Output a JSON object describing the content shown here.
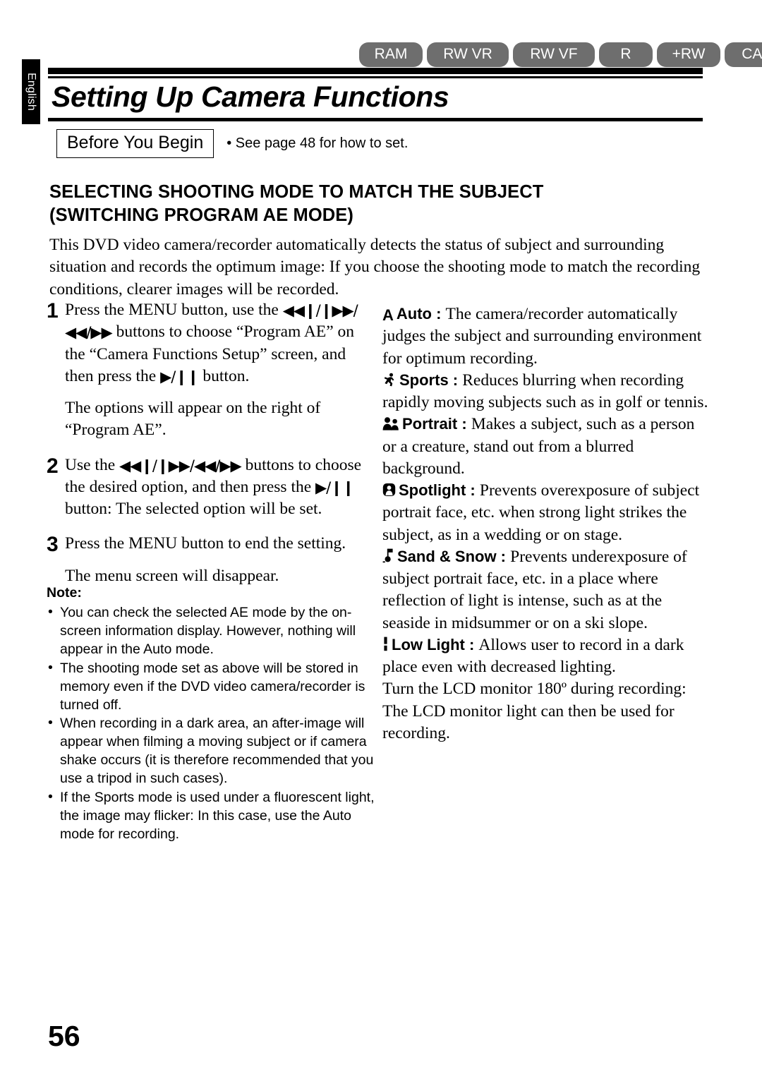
{
  "language_tab": "English",
  "media_badges": [
    {
      "id": "ram",
      "label": "RAM"
    },
    {
      "id": "rw-vr",
      "label": "RW VR"
    },
    {
      "id": "rw-vf",
      "label": "RW VF"
    },
    {
      "id": "r",
      "label": "R"
    },
    {
      "id": "plus-rw",
      "label": "+RW"
    },
    {
      "id": "card",
      "label": "CARD"
    }
  ],
  "badge_color": "#6e6e6e",
  "header": {
    "title": "Setting Up Camera Functions"
  },
  "before_you_begin": {
    "box_label": "Before You Begin",
    "note": "• See page 48 for how to set."
  },
  "section": {
    "heading_line1": "SELECTING SHOOTING MODE TO MATCH THE SUBJECT",
    "heading_line2": "(SWITCHING PROGRAM AE MODE)",
    "intro": "This DVD video camera/recorder automatically detects the status of subject and surrounding situation and records the optimum image: If you choose the shooting mode to match the recording conditions, clearer images will be recorded."
  },
  "steps": [
    {
      "number": "1",
      "text_part1": "Press the MENU button, use the ",
      "glyph1": "⏮⏭",
      "text_part2": " buttons to choose “Program AE” on the “Camera Functions Setup” screen, and then press the ",
      "glyph2": "▶/❙❙",
      "text_part3": " button.",
      "sub": "The options will appear on the right of “Program AE”."
    },
    {
      "number": "2",
      "text_part1": "Use the ",
      "glyph1": "⏮⏭",
      "text_part2": " buttons to choose the desired option, and then press the ",
      "glyph2": "▶/❙❙",
      "text_part3": " button: The selected option will be set.",
      "sub": ""
    },
    {
      "number": "3",
      "text_part1": "Press the MENU button to end the setting.",
      "glyph1": "",
      "text_part2": "",
      "glyph2": "",
      "text_part3": "",
      "sub": "The menu screen will disappear."
    }
  ],
  "glyphs": {
    "skip_back": "◀◀❙",
    "skip_fwd": "❙▶▶",
    "rew": "◀◀",
    "ff": "▶▶",
    "play_pause": "▶/❙❙",
    "slash": "/"
  },
  "note": {
    "title": "Note:",
    "items": [
      "You can check the selected AE mode by the on-screen information display. However, nothing will appear in the Auto mode.",
      "The shooting mode set as above will be stored in memory even if the DVD video camera/recorder is turned off.",
      "When recording in a dark area, an after-image will appear when filming a moving subject or if camera shake occurs (it is therefore recommended that you use a tripod in such cases).",
      "If the Sports mode is used under a fluorescent light, the image may flicker: In this case, use the Auto mode for recording."
    ]
  },
  "modes": [
    {
      "icon": "letter-a-icon",
      "name": "Auto",
      "separator": " : ",
      "description": "The camera/recorder automatically judges the subject and surrounding environment for optimum recording."
    },
    {
      "icon": "running-person-icon",
      "name": "Sports",
      "separator": " : ",
      "description": "Reduces blurring when recording rapidly moving subjects such as in golf or tennis."
    },
    {
      "icon": "two-people-icon",
      "name": "Portrait",
      "separator": " : ",
      "description": "Makes a subject, such as a person or a creature, stand out from a blurred background."
    },
    {
      "icon": "spotlight-icon",
      "name": "Spotlight",
      "separator": " : ",
      "description": "Prevents overexposure of subject portrait face, etc. when strong light strikes the subject, as in a wedding or on stage."
    },
    {
      "icon": "sand-snow-icon",
      "name": "Sand & Snow",
      "separator": " : ",
      "description": "Prevents underexposure of subject portrait face, etc. in a place where reflection of light is intense, such as at the seaside in midsummer or on a ski slope."
    },
    {
      "icon": "low-light-icon",
      "name": "Low Light",
      "separator": " : ",
      "description": "Allows user to record in a dark place even with decreased lighting."
    }
  ],
  "closing_paragraph": "Turn the LCD monitor 180º during recording: The LCD monitor light can then be used for recording.",
  "page_number": "56"
}
